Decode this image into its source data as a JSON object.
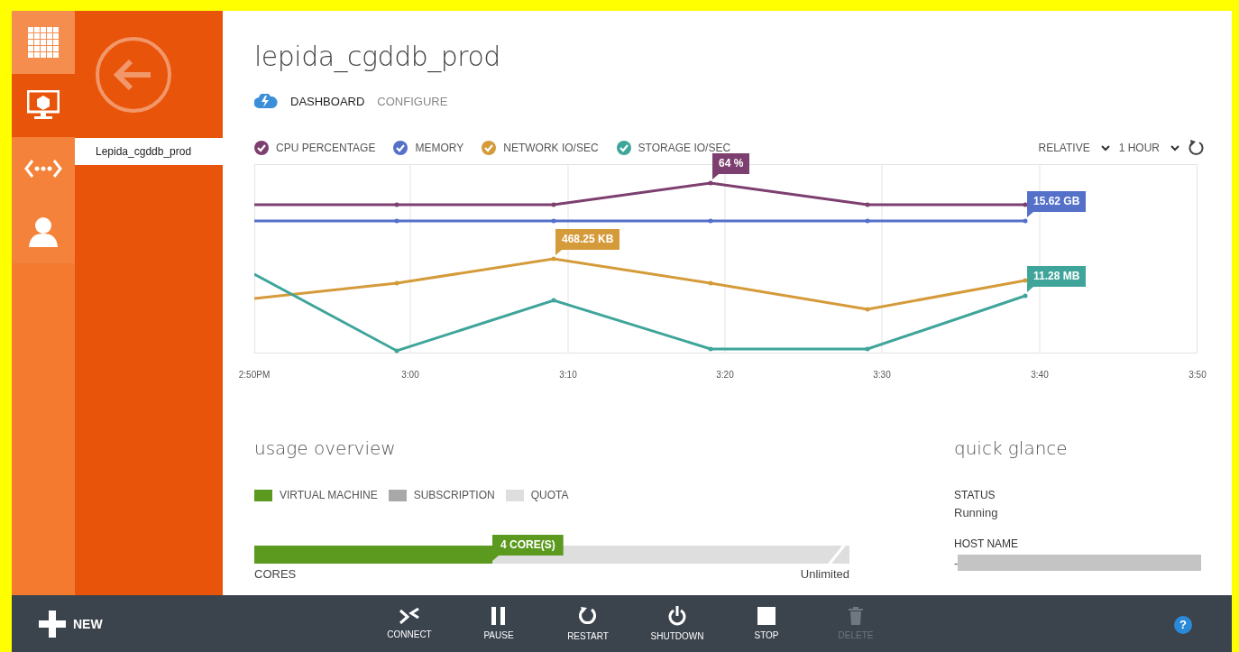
{
  "nav_rail": {
    "items": [
      {
        "kind": "grid",
        "selected": false
      },
      {
        "kind": "vm",
        "selected": true
      },
      {
        "kind": "network",
        "selected": false
      },
      {
        "kind": "user",
        "selected": false
      }
    ]
  },
  "nav_panel": {
    "items": [
      {
        "label": "Lepida_cgddb_prod",
        "selected": true
      }
    ]
  },
  "title": "lepida_cgddb_prod",
  "tabs": [
    {
      "label": "DASHBOARD",
      "selected": true
    },
    {
      "label": "CONFIGURE",
      "selected": false
    }
  ],
  "chart": {
    "legend": [
      {
        "name": "CPU PERCENTAGE",
        "color": "#7d3f6f",
        "checked": true,
        "callout": "64 %"
      },
      {
        "name": "MEMORY",
        "color": "#5470c9",
        "checked": true,
        "callout": "15.62 GB"
      },
      {
        "name": "NETWORK IO/SEC",
        "color": "#d59b3a",
        "checked": true,
        "callout": "468.25 KB"
      },
      {
        "name": "STORAGE IO/SEC",
        "color": "#3fa59b",
        "checked": true,
        "callout": "11.28 MB"
      }
    ],
    "range": [
      "RELATIVE",
      "1 HOUR"
    ],
    "x_labels": [
      "2:50PM",
      "3:00",
      "3:10",
      "3:20",
      "3:30",
      "3:40",
      "3:50"
    ]
  },
  "usage": {
    "title": "usage overview",
    "legend": [
      {
        "label": "VIRTUAL MACHINE",
        "color": "#5b9a1f"
      },
      {
        "label": "SUBSCRIPTION",
        "color": "#a8a8a8"
      },
      {
        "label": "QUOTA",
        "color": "#dedede"
      }
    ],
    "bars": [
      {
        "label": "CORES",
        "level": 0.4,
        "badge": "4 CORE(S)",
        "limit": "Unlimited"
      }
    ]
  },
  "quick_glance": {
    "title": "quick glance",
    "fields": [
      {
        "label": "STATUS",
        "value": "Running",
        "redacted": false
      },
      {
        "label": "HOST NAME",
        "value": "-",
        "redacted": true
      }
    ]
  },
  "command_bar": {
    "new": "NEW",
    "buttons": [
      {
        "kind": "connect",
        "label": "CONNECT",
        "disabled": false
      },
      {
        "kind": "pause",
        "label": "PAUSE",
        "disabled": false
      },
      {
        "kind": "restart",
        "label": "RESTART",
        "disabled": false
      },
      {
        "kind": "shutdown",
        "label": "SHUTDOWN",
        "disabled": false
      },
      {
        "kind": "stop",
        "label": "STOP",
        "disabled": false
      },
      {
        "kind": "delete",
        "label": "DELETE",
        "disabled": true
      }
    ],
    "help": "?"
  }
}
